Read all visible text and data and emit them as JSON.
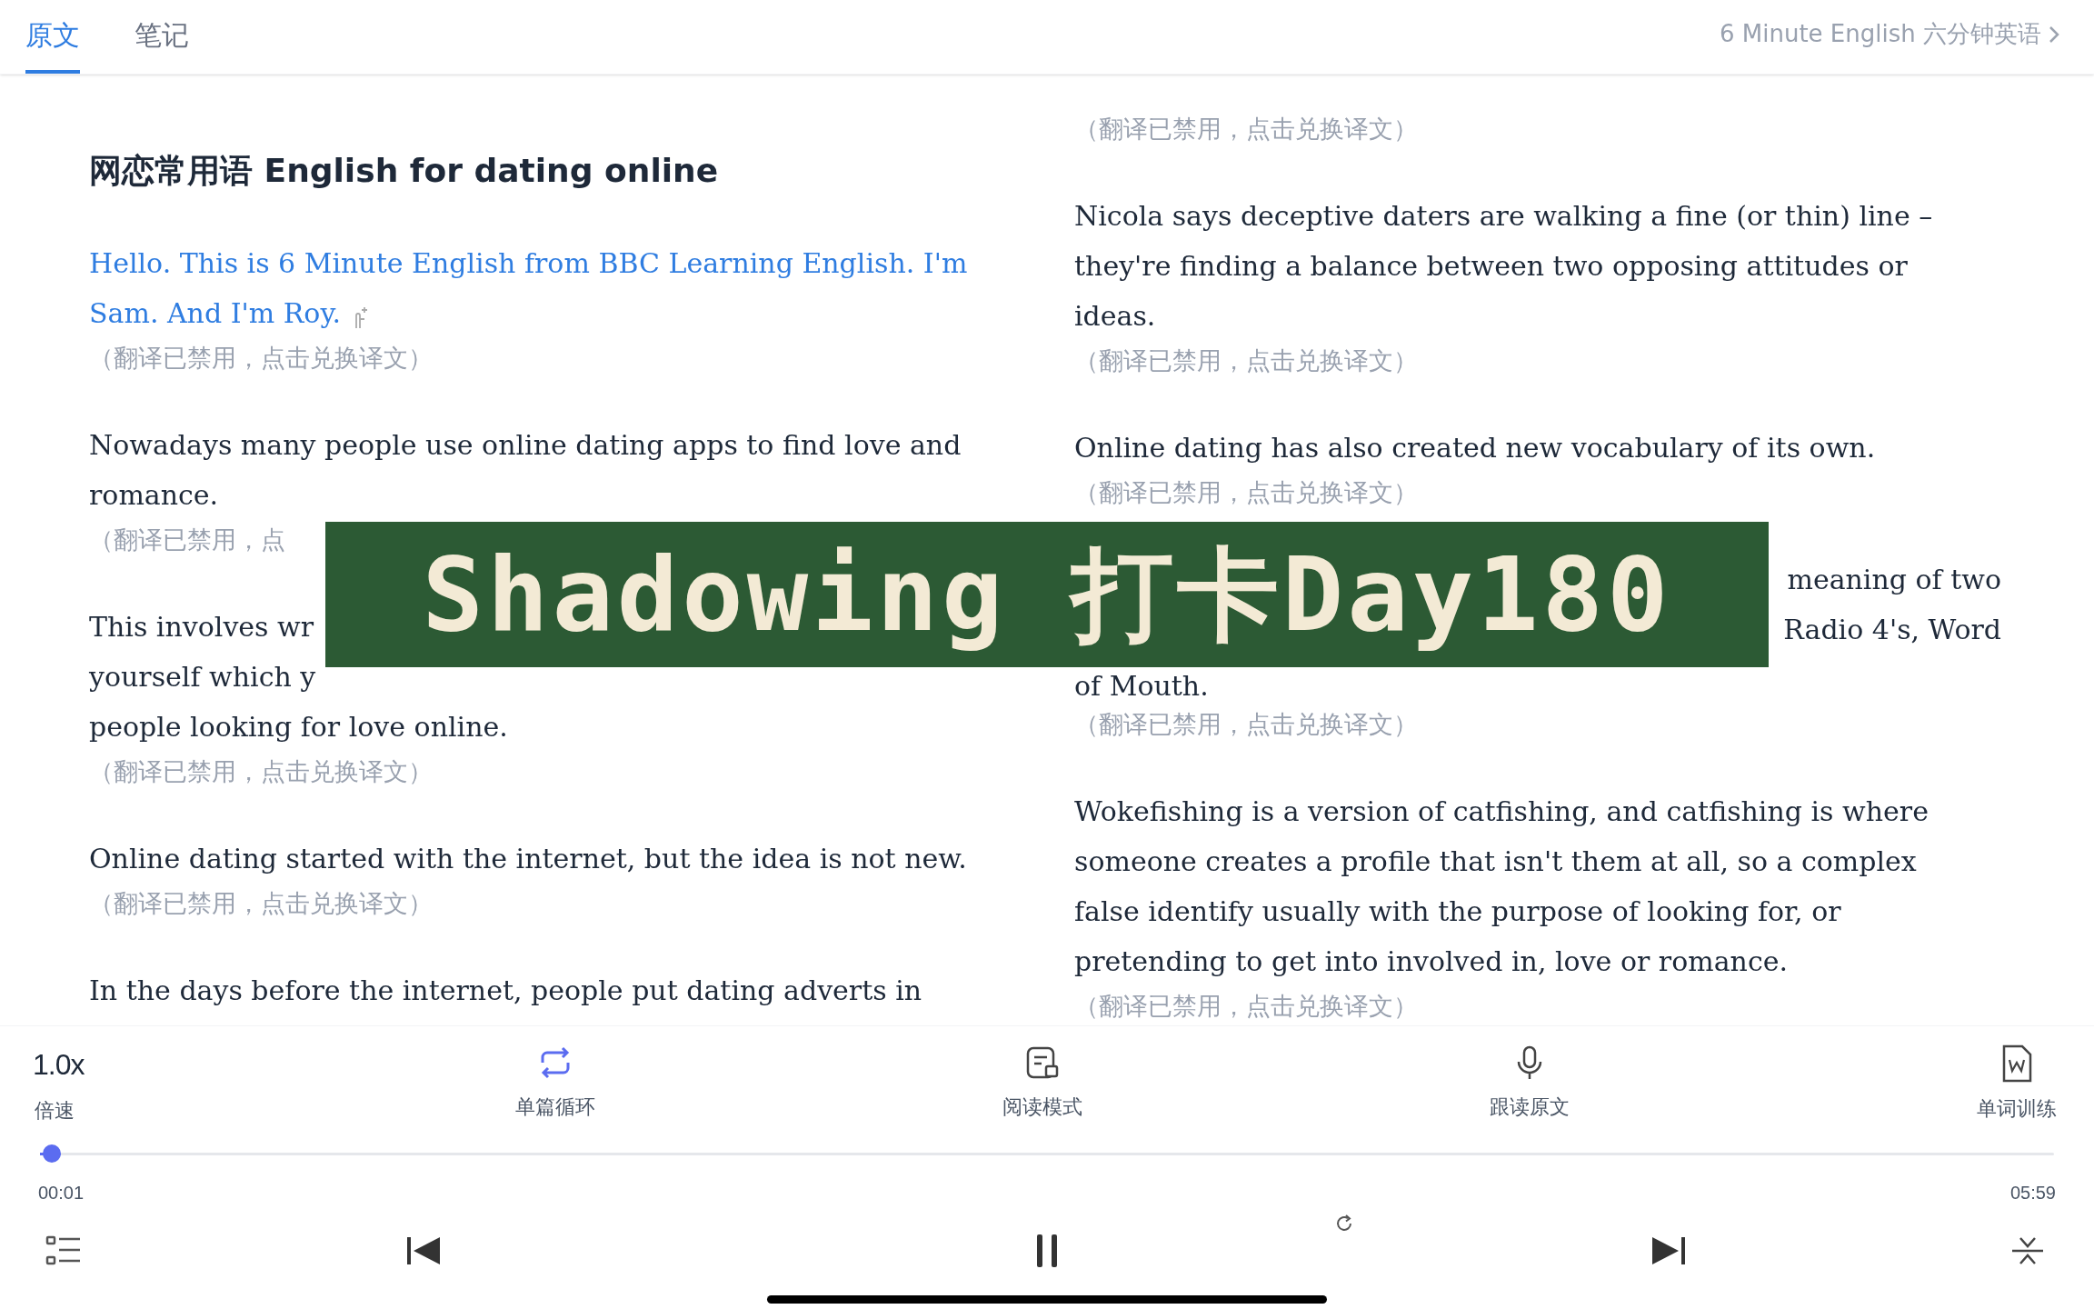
{
  "tabs": [
    {
      "label": "原文",
      "selected": true
    },
    {
      "label": "笔记",
      "selected": false
    }
  ],
  "course_link": "6 Minute English 六分钟英语",
  "title": "网恋常用语 English for dating online",
  "columns": [
    [
      {
        "kind": "text",
        "active": true,
        "text": "Hello. This is 6 Minute English from BBC Learning English. I'm Sam. And I'm Roy.",
        "translation": "（翻译已禁用，点击兑换译文）"
      },
      {
        "kind": "text",
        "active": false,
        "text": "Nowadays many people use online dating apps to find love and romance.",
        "translation": "（翻译已禁用，点"
      },
      {
        "kind": "covered",
        "lines": [
          "This involves wr",
          "yourself which y",
          "people looking for love online."
        ],
        "translation": "（翻译已禁用，点击兑换译文）"
      },
      {
        "kind": "text",
        "active": false,
        "text": "Online dating started with the internet, but the idea is not new.",
        "translation": "（翻译已禁用，点击兑换译文）"
      },
      {
        "kind": "text",
        "active": false,
        "text": "In the days before the internet, people put dating adverts in"
      }
    ],
    [
      {
        "kind": "translation_only",
        "translation": "（翻译已禁用，点击兑换译文）"
      },
      {
        "kind": "text",
        "active": false,
        "text": "Nicola says deceptive daters are walking a fine (or thin) line – they're finding a balance between two opposing attitudes or ideas.",
        "translation": "（翻译已禁用，点击兑换译文）"
      },
      {
        "kind": "text",
        "active": false,
        "text": "Online dating has also created new vocabulary of its own.",
        "translation": "（翻译已禁用，点击兑换译文）"
      },
      {
        "kind": "covered_right",
        "lines": [
          "meaning of two",
          "Radio 4's, Word",
          "of Mouth."
        ],
        "translation": "（翻译已禁用，点击兑换译文）"
      },
      {
        "kind": "text",
        "active": false,
        "text": "Wokefishing is a version of catfishing, and catfishing is where someone creates a profile that isn't them at all, so a complex false identify usually with the purpose of looking for, or pretending to get into involved in, love or romance.",
        "translation": "（翻译已禁用，点击兑换译文）"
      }
    ]
  ],
  "banner": "Shadowing 打卡Day180",
  "toolbar": [
    {
      "kind": "speed",
      "icon_text": "1.0x",
      "label": "倍速"
    },
    {
      "kind": "loop",
      "label": "单篇循环"
    },
    {
      "kind": "reading",
      "label": "阅读模式"
    },
    {
      "kind": "mic",
      "label": "跟读原文"
    },
    {
      "kind": "word",
      "label": "单词训练"
    }
  ],
  "progress": {
    "level": 0.006,
    "elapsed": "00:01",
    "total": "05:59"
  }
}
